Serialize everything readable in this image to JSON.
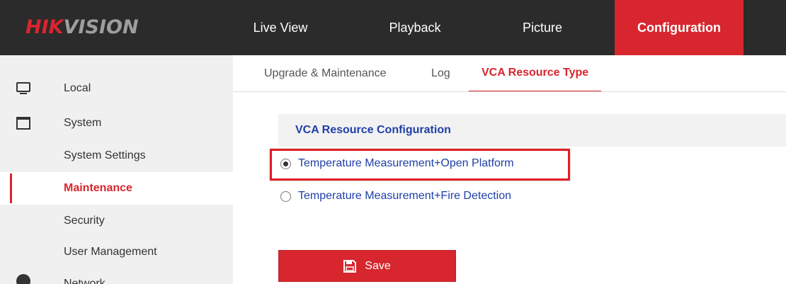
{
  "brand": {
    "name_part1": "HIK",
    "name_part2": "VISION"
  },
  "topnav": {
    "items": [
      {
        "label": "Live View"
      },
      {
        "label": "Playback"
      },
      {
        "label": "Picture"
      },
      {
        "label": "Configuration",
        "active": true
      }
    ]
  },
  "sidebar": {
    "local": {
      "label": "Local",
      "icon": "monitor-icon"
    },
    "system": {
      "label": "System",
      "icon": "window-icon"
    },
    "subitems": [
      {
        "label": "System Settings"
      },
      {
        "label": "Maintenance",
        "active": true
      },
      {
        "label": "Security"
      },
      {
        "label": "User Management"
      }
    ],
    "network": {
      "label": "Network",
      "icon": "globe-icon"
    }
  },
  "tabs": [
    {
      "label": "Upgrade & Maintenance"
    },
    {
      "label": "Log"
    },
    {
      "label": "VCA Resource Type",
      "active": true
    }
  ],
  "section": {
    "title": "VCA Resource Configuration"
  },
  "options": [
    {
      "label": "Temperature Measurement+Open Platform",
      "checked": true
    },
    {
      "label": "Temperature Measurement+Fire Detection",
      "checked": false
    }
  ],
  "save": {
    "label": "Save",
    "icon": "floppy-disk-icon"
  },
  "colors": {
    "accent": "#d7262e",
    "topbar": "#2b2b2b",
    "sidebar": "#f0f0f0",
    "link": "#1f3fa8"
  }
}
